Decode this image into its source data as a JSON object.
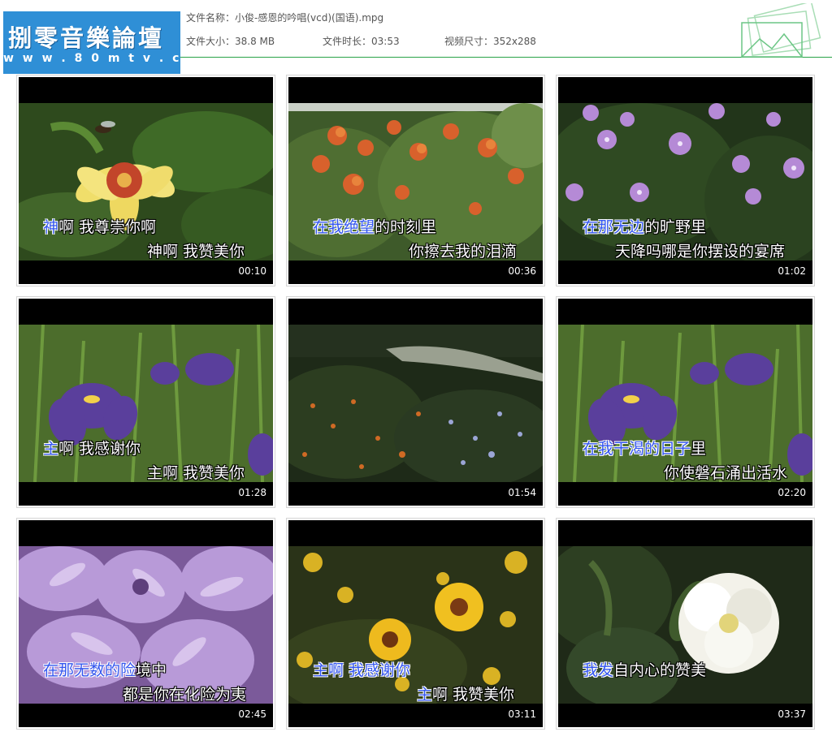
{
  "header": {
    "logo_title": "捌零音樂論壇",
    "logo_url": "w w w . 8 0 m t v . c o m",
    "file_name_label": "文件名称：",
    "file_name": "小俊-感恩的吟唱(vcd)(国语).mpg",
    "file_size_label": "文件大小：",
    "file_size": "38.8 MB",
    "duration_label": "文件时长：",
    "duration": "03:53",
    "resolution_label": "视频尺寸：",
    "resolution": "352x288"
  },
  "colors": {
    "logo_bg": "#2f8fd6",
    "accent_green": "#29a347",
    "karaoke_highlight": "#3355ee"
  },
  "thumbnails": [
    {
      "time": "00:10",
      "scene": "yellow-lily-with-bee",
      "line1_hl": "神",
      "line1_rest": "啊  我尊崇你啊",
      "line2_hl": "",
      "line2_rest": "神啊  我赞美你"
    },
    {
      "time": "00:36",
      "scene": "orange-flower-bush",
      "line1_hl": "在我绝望",
      "line1_rest": "的时刻里",
      "line2_hl": "",
      "line2_rest": "你擦去我的泪滴"
    },
    {
      "time": "01:02",
      "scene": "purple-flowers",
      "line1_hl": "在那无边",
      "line1_rest": "的旷野里",
      "line2_hl": "",
      "line2_rest": "天降吗哪是你摆设的宴席"
    },
    {
      "time": "01:28",
      "scene": "purple-iris",
      "line1_hl": "主",
      "line1_rest": "啊  我感谢你",
      "line2_hl": "",
      "line2_rest": "主啊  我赞美你"
    },
    {
      "time": "01:54",
      "scene": "garden-path",
      "line1_hl": "",
      "line1_rest": "",
      "line2_hl": "",
      "line2_rest": ""
    },
    {
      "time": "02:20",
      "scene": "purple-iris",
      "line1_hl": "在我干渴的日子",
      "line1_rest": "里",
      "line2_hl": "",
      "line2_rest": "你使磐石涌出活水"
    },
    {
      "time": "02:45",
      "scene": "lilac-blossoms",
      "line1_hl": "在那无数的险",
      "line1_rest": "境中",
      "line2_hl": "",
      "line2_rest": "都是你在化险为夷"
    },
    {
      "time": "03:11",
      "scene": "yellow-daisies",
      "line1_hl": "主啊  我感谢你",
      "line1_rest": "",
      "line2_hl": "主",
      "line2_rest": "啊  我赞美你"
    },
    {
      "time": "03:37",
      "scene": "white-camellia",
      "line1_hl": "我发",
      "line1_rest": "自内心的赞美",
      "line2_hl": "",
      "line2_rest": ""
    }
  ]
}
